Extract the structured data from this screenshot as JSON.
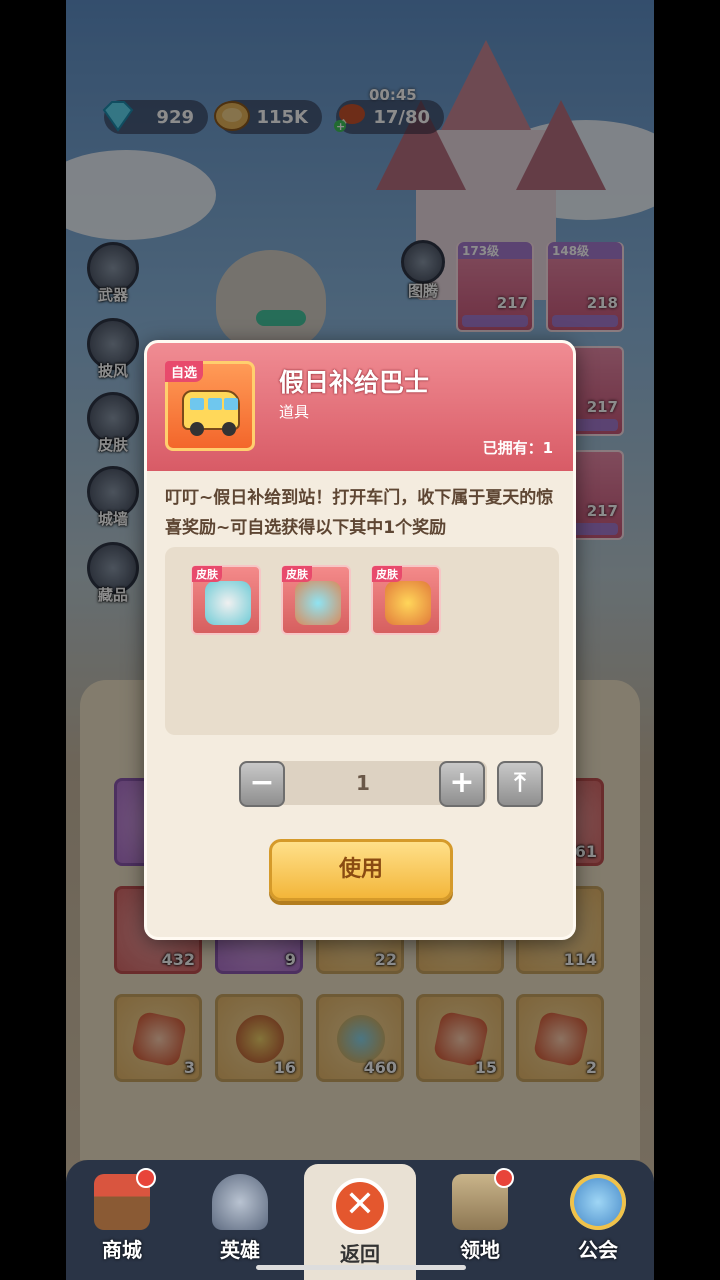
{
  "hud": {
    "diamonds": "929",
    "coins": "115K",
    "stamina": "17/80",
    "timer": "00:45"
  },
  "side_menu": [
    {
      "label": "武器"
    },
    {
      "label": "披风"
    },
    {
      "label": "皮肤"
    },
    {
      "label": "城墙"
    },
    {
      "label": "藏品"
    }
  ],
  "totem": {
    "label": "图腾"
  },
  "equip_cards": [
    {
      "level": "173级",
      "count": "217"
    },
    {
      "level": "148级",
      "count": "218"
    },
    {
      "count": "217"
    },
    {
      "count": "217"
    }
  ],
  "inventory_rows": [
    [
      {
        "count": ""
      },
      {
        "count": ""
      },
      {
        "count": ""
      },
      {
        "count": ""
      },
      {
        "count": "61"
      }
    ],
    [
      {
        "count": "432"
      },
      {
        "count": "9"
      },
      {
        "count": "22"
      },
      {
        "count": ""
      },
      {
        "count": "114"
      }
    ],
    [
      {
        "count": "3"
      },
      {
        "count": "16"
      },
      {
        "count": "460"
      },
      {
        "count": "15"
      },
      {
        "count": "2"
      }
    ]
  ],
  "dialog": {
    "tag": "自选",
    "title": "假日补给巴士",
    "type": "道具",
    "owned": "已拥有：1",
    "description": "叮叮~假日补给到站！打开车门，收下属于夏天的惊喜奖励~可自选获得以下其中1个奖励",
    "rewards": [
      {
        "tag": "皮肤",
        "icon": "hero-skin-icon"
      },
      {
        "tag": "皮肤",
        "icon": "weapon-skin-icon"
      },
      {
        "tag": "皮肤",
        "icon": "gun-skin-icon"
      }
    ],
    "quantity": "1",
    "minus": "−",
    "plus": "+",
    "max": "⤒",
    "use_label": "使用"
  },
  "bottom_nav": [
    {
      "label": "商城",
      "badge": true
    },
    {
      "label": "英雄",
      "badge": false
    },
    {
      "label": "返回",
      "badge": false,
      "active": true
    },
    {
      "label": "领地",
      "badge": true
    },
    {
      "label": "公会",
      "badge": false
    }
  ],
  "colors": {
    "dialog_header": "#e07079",
    "use_button": "#f3b63a",
    "badge": "#e8443a"
  }
}
